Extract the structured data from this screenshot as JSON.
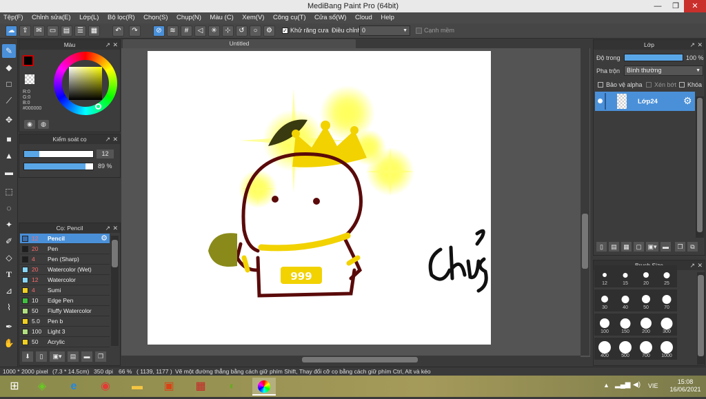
{
  "window": {
    "title": "MediBang Paint Pro (64bit)",
    "minimize": "—",
    "restore": "❐",
    "close": "✕"
  },
  "menu": [
    "Tệp(F)",
    "Chỉnh sửa(E)",
    "Lớp(L)",
    "Bộ lọc(R)",
    "Chọn(S)",
    "Chụp(N)",
    "Màu (C)",
    "Xem(V)",
    "Công cụ(T)",
    "Cửa sổ(W)",
    "Cloud",
    "Help"
  ],
  "toolbar": {
    "antialias_label": "Khử răng cưa",
    "correction_label": "Điều chỉnh",
    "correction_value": "0",
    "snap_label": "Cạnh mềm"
  },
  "color_panel": {
    "title": "Màu",
    "r": "R:0",
    "g": "G:0",
    "b": "B:0",
    "hex": "#000000",
    "fg_color": "#000000",
    "accent": "#cc0000"
  },
  "brush_control": {
    "title": "Kiểm soát cọ",
    "size_value": "12",
    "opacity_value": "89 %"
  },
  "brush_panel": {
    "title": "Cọ: Pencil",
    "items": [
      {
        "size": "12",
        "name": "Pencil",
        "color": "#3a6fb0"
      },
      {
        "size": "20",
        "name": "Pen",
        "color": "#1e1e1e"
      },
      {
        "size": "4",
        "name": "Pen (Sharp)",
        "color": "#1e1e1e"
      },
      {
        "size": "20",
        "name": "Watercolor (Wet)",
        "color": "#87d5f5"
      },
      {
        "size": "12",
        "name": "Watercolor",
        "color": "#87d5f5"
      },
      {
        "size": "4",
        "name": "Sumi",
        "color": "#f0d020"
      },
      {
        "size": "10",
        "name": "Edge Pen",
        "color": "#40c040"
      },
      {
        "size": "50",
        "name": "Fluffy Watercolor",
        "color": "#b0e080"
      },
      {
        "size": "5.0",
        "name": "Pen b",
        "color": "#f0d020"
      },
      {
        "size": "100",
        "name": "Light 3",
        "color": "#b0e080"
      },
      {
        "size": "50",
        "name": "Acrylic",
        "color": "#f0d020"
      }
    ]
  },
  "canvas": {
    "tab_title": "Untitled",
    "scribble_text": "chug?"
  },
  "layer_panel": {
    "title": "Lớp",
    "opacity_label": "Độ trong",
    "opacity_value": "100 %",
    "blend_label": "Pha trộn",
    "blend_value": "Bình thường",
    "protect_alpha": "Bảo vệ alpha",
    "clipping": "Xén bớt",
    "lock": "Khóa",
    "layer_name": "Lớp24"
  },
  "brush_size_panel": {
    "title": "Brush Size",
    "sizes": [
      "12",
      "15",
      "20",
      "25",
      "30",
      "40",
      "50",
      "70",
      "100",
      "150",
      "200",
      "300",
      "400",
      "500",
      "700",
      "1000"
    ]
  },
  "status": {
    "dimensions": "1000 * 2000 pixel",
    "physical": "(7.3 * 14.5cm)",
    "dpi": "350 dpi",
    "zoom": "66 %",
    "coords": "( 1139, 1177 )",
    "hint": "Vẽ một đường thẳng bằng cách giữ phím Shift, Thay đổi cỡ cọ bằng cách giữ phím Ctrl, Alt và kéo"
  },
  "taskbar": {
    "time": "15:08",
    "date": "16/06/2021",
    "language": "VIE"
  }
}
